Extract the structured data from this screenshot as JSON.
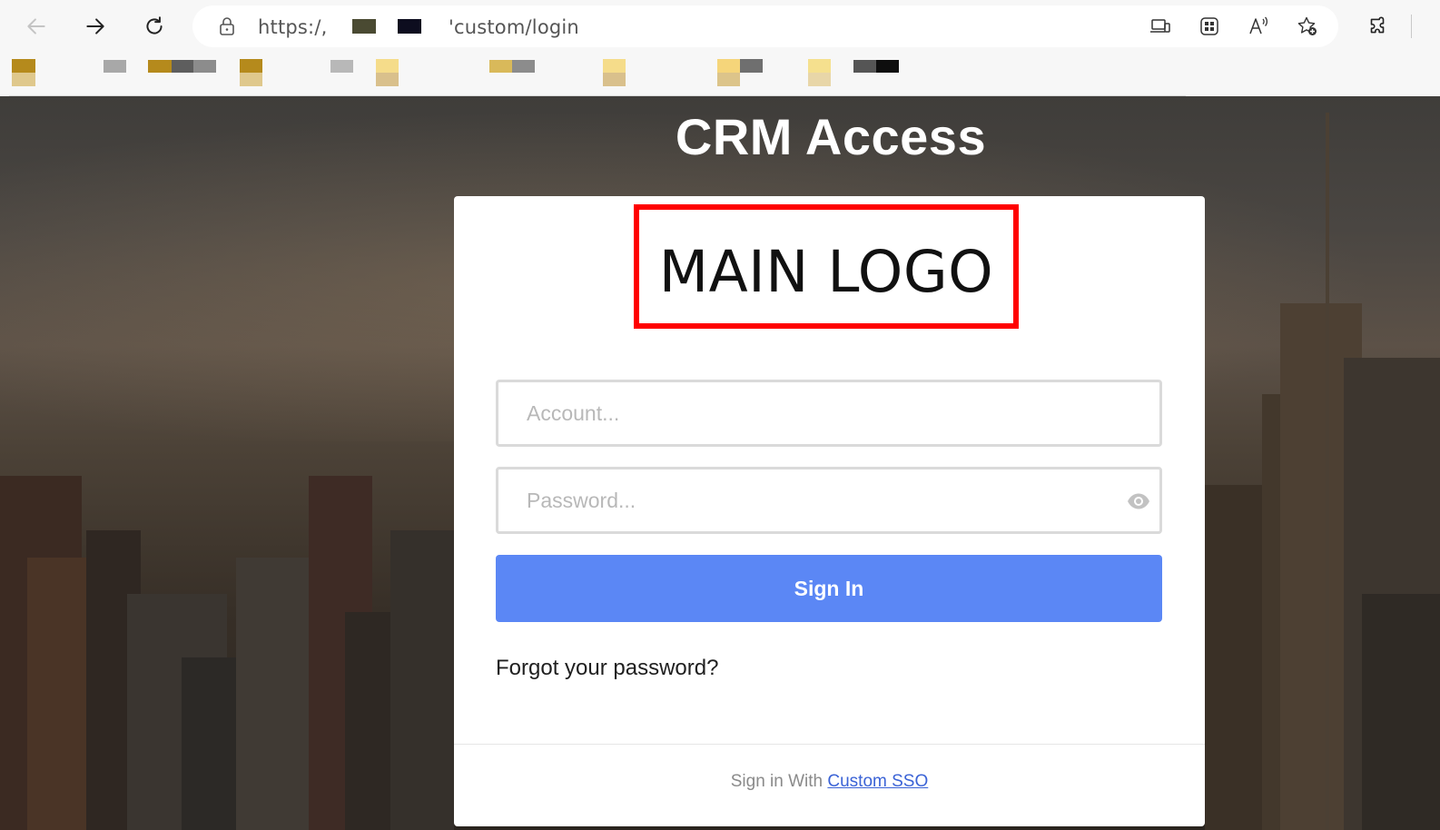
{
  "browser": {
    "url_prefix": "https:/,",
    "url_suffix": "'custom/login",
    "nav": {
      "back_icon": "back-arrow-icon",
      "forward_icon": "forward-arrow-icon",
      "refresh_icon": "refresh-icon"
    },
    "address_icons": [
      "devices-icon",
      "apps-icon",
      "read-aloud-icon",
      "add-favorite-icon"
    ],
    "extensions_icon": "puzzle-icon",
    "redaction_colors": [
      "#4a4a32",
      "#0d0d1f"
    ]
  },
  "bookmarks": {
    "item_colors": [
      "#b58a1c",
      "#a8a8a8",
      "#6a6a6a",
      "#f5dc8a",
      "#d9b95a",
      "#3c3c3c"
    ]
  },
  "page": {
    "title": "CRM Access"
  },
  "login": {
    "logo_text": "MAIN LOGO",
    "logo_border_color": "#ff0000",
    "account_placeholder": "Account...",
    "account_value": "",
    "password_placeholder": "Password...",
    "password_value": "",
    "show_password_icon": "eye-icon",
    "signin_label": "Sign In",
    "signin_color": "#5b87f5",
    "forgot_label": "Forgot your password?",
    "sso_prefix": "Sign in With",
    "sso_link": "Custom SSO"
  }
}
